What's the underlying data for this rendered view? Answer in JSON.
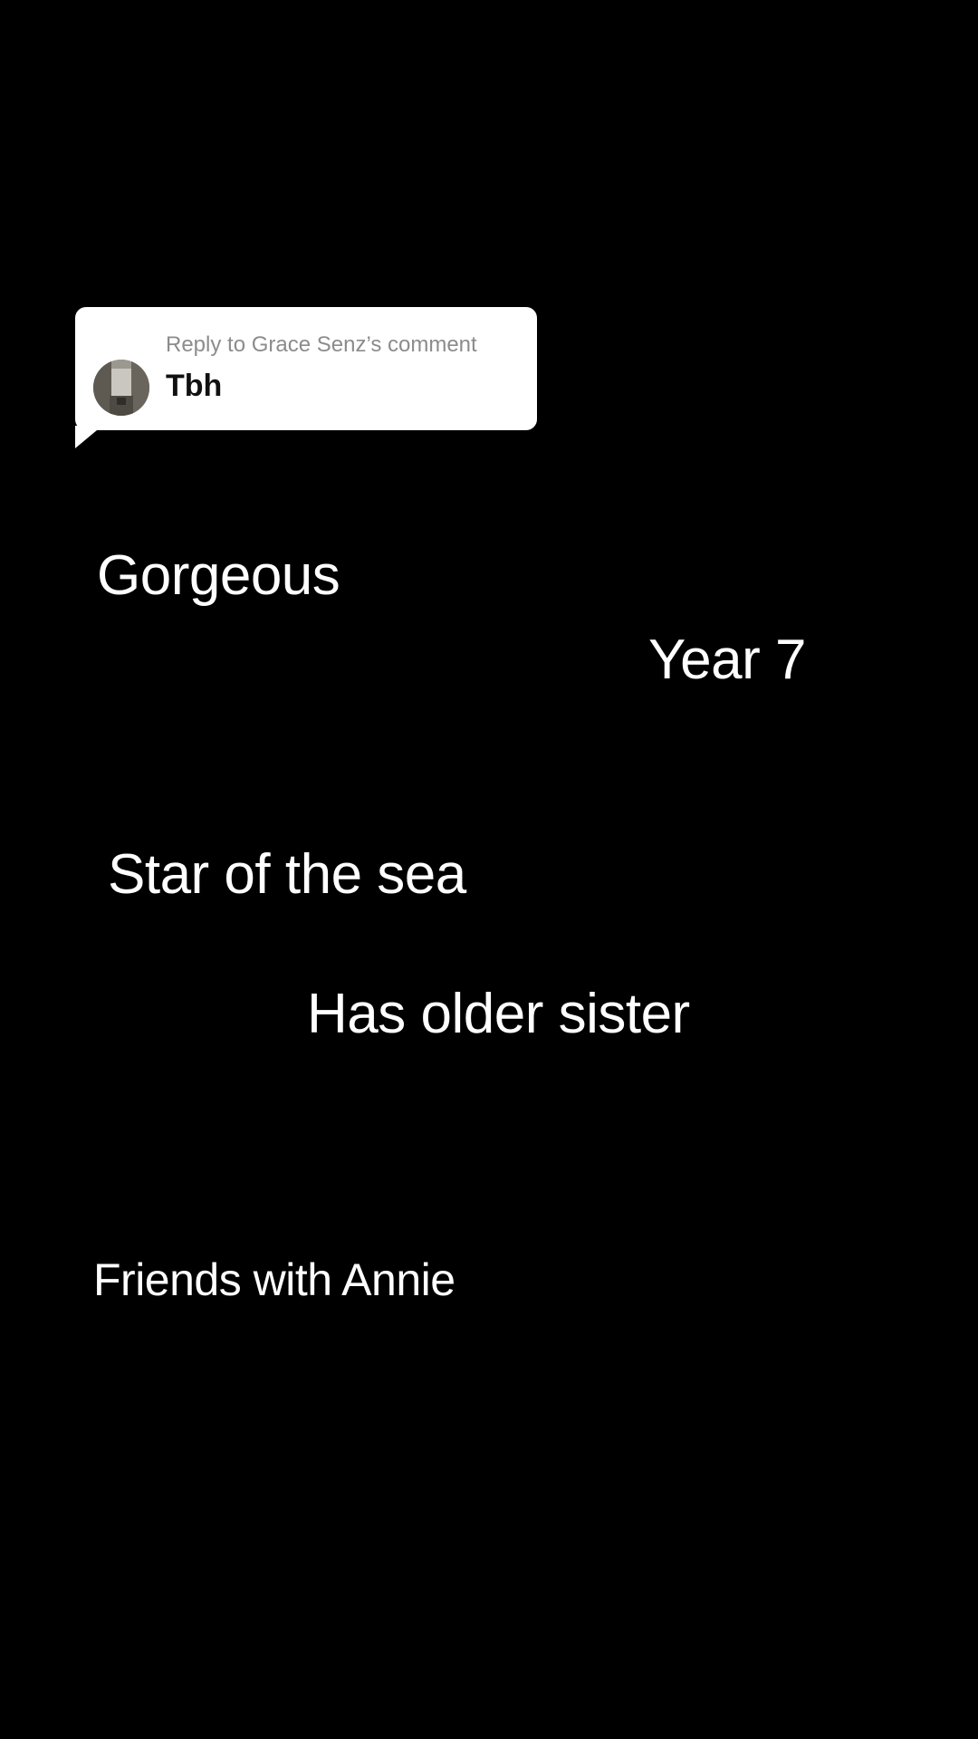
{
  "reply": {
    "header": "Reply to Grace Senz’s comment",
    "comment": "Tbh",
    "avatar_icon": "user-avatar-photo"
  },
  "overlay_texts": {
    "gorgeous": "Gorgeous",
    "year": "Year 7",
    "star": "Star of the sea",
    "sister": "Has older sister",
    "friends": "Friends with Annie"
  },
  "colors": {
    "background": "#000000",
    "text": "#ffffff",
    "bubble": "#ffffff",
    "bubble_header": "#8c8c8c"
  }
}
